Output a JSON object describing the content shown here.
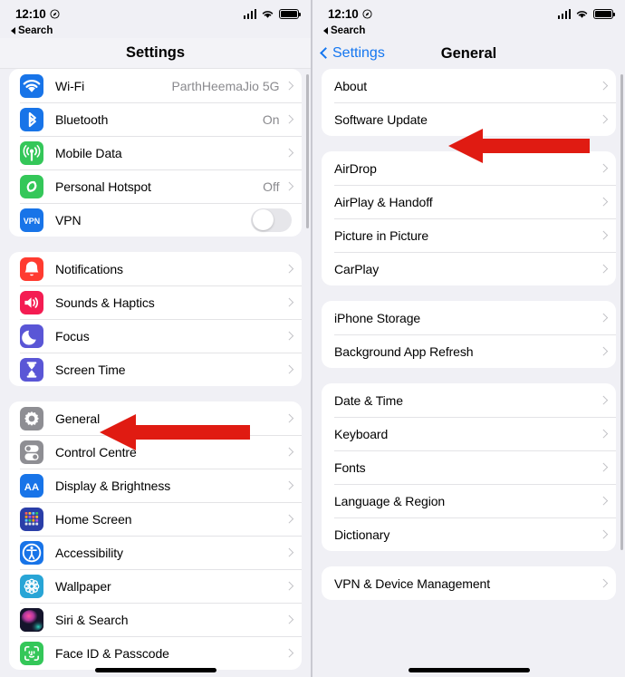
{
  "status_bar": {
    "time": "12:10",
    "location_icon": "location-arrow-icon",
    "back_label": "Search",
    "signal_icon": "cellular-bars-icon",
    "wifi_icon": "wifi-icon",
    "battery_icon": "battery-full-icon"
  },
  "left_panel": {
    "title": "Settings",
    "groups": [
      {
        "rows": [
          {
            "label": "Wi-Fi",
            "value": "ParthHeemaJio 5G",
            "accessory": "chevron",
            "icon": "wifi-icon",
            "icon_color": "#1874e8"
          },
          {
            "label": "Bluetooth",
            "value": "On",
            "accessory": "chevron",
            "icon": "bluetooth-icon",
            "icon_color": "#1874e8"
          },
          {
            "label": "Mobile Data",
            "value": "",
            "accessory": "chevron",
            "icon": "cellular-tower-icon",
            "icon_color": "#34c759"
          },
          {
            "label": "Personal Hotspot",
            "value": "Off",
            "accessory": "chevron",
            "icon": "hotspot-link-icon",
            "icon_color": "#34c759"
          },
          {
            "label": "VPN",
            "value": "",
            "accessory": "toggle",
            "toggle_on": false,
            "icon": "vpn-icon",
            "icon_color": "#1874e8"
          }
        ]
      },
      {
        "rows": [
          {
            "label": "Notifications",
            "value": "",
            "accessory": "chevron",
            "icon": "bell-icon",
            "icon_color": "#ff3b30"
          },
          {
            "label": "Sounds & Haptics",
            "value": "",
            "accessory": "chevron",
            "icon": "speaker-icon",
            "icon_color": "#f41c52"
          },
          {
            "label": "Focus",
            "value": "",
            "accessory": "chevron",
            "icon": "moon-icon",
            "icon_color": "#5a56d6"
          },
          {
            "label": "Screen Time",
            "value": "",
            "accessory": "chevron",
            "icon": "hourglass-icon",
            "icon_color": "#5a56d6"
          }
        ]
      },
      {
        "rows": [
          {
            "label": "General",
            "value": "",
            "accessory": "chevron",
            "icon": "gear-icon",
            "icon_color": "#8e8e93"
          },
          {
            "label": "Control Centre",
            "value": "",
            "accessory": "chevron",
            "icon": "toggles-icon",
            "icon_color": "#8e8e93"
          },
          {
            "label": "Display & Brightness",
            "value": "",
            "accessory": "chevron",
            "icon": "aa-text-icon",
            "icon_color": "#1874e8"
          },
          {
            "label": "Home Screen",
            "value": "",
            "accessory": "chevron",
            "icon": "home-screen-grid-icon",
            "icon_color": "#2a3ea8"
          },
          {
            "label": "Accessibility",
            "value": "",
            "accessory": "chevron",
            "icon": "accessibility-icon",
            "icon_color": "#1874e8"
          },
          {
            "label": "Wallpaper",
            "value": "",
            "accessory": "chevron",
            "icon": "wallpaper-flower-icon",
            "icon_color": "#28a5d6"
          },
          {
            "label": "Siri & Search",
            "value": "",
            "accessory": "chevron",
            "icon": "siri-orb-icon",
            "icon_color": "#1b1b2e"
          },
          {
            "label": "Face ID & Passcode",
            "value": "",
            "accessory": "chevron",
            "icon": "face-id-icon",
            "icon_color": "#34c759"
          }
        ]
      }
    ]
  },
  "right_panel": {
    "title": "General",
    "back_label": "Settings",
    "groups": [
      {
        "rows": [
          {
            "label": "About"
          },
          {
            "label": "Software Update"
          }
        ]
      },
      {
        "rows": [
          {
            "label": "AirDrop"
          },
          {
            "label": "AirPlay & Handoff"
          },
          {
            "label": "Picture in Picture"
          },
          {
            "label": "CarPlay"
          }
        ]
      },
      {
        "rows": [
          {
            "label": "iPhone Storage"
          },
          {
            "label": "Background App Refresh"
          }
        ]
      },
      {
        "rows": [
          {
            "label": "Date & Time"
          },
          {
            "label": "Keyboard"
          },
          {
            "label": "Fonts"
          },
          {
            "label": "Language & Region"
          },
          {
            "label": "Dictionary"
          }
        ]
      },
      {
        "rows": [
          {
            "label": "VPN & Device Management"
          }
        ]
      }
    ]
  },
  "annotations": {
    "arrow_color": "#e01b12",
    "arrow_left_target": "General",
    "arrow_right_target": "Software Update"
  }
}
